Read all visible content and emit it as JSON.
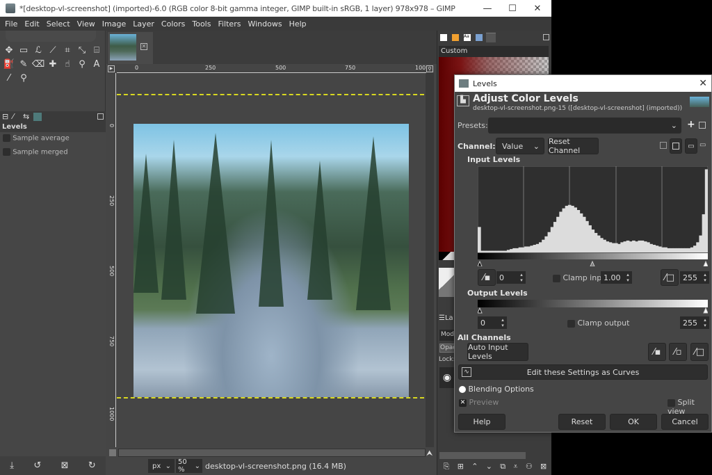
{
  "window": {
    "title": "*[desktop-vl-screenshot] (imported)-6.0 (RGB color 8-bit gamma integer, GIMP built-in sRGB, 1 layer) 978x978 – GIMP",
    "minimize": "—",
    "maximize": "☐",
    "close": "✕"
  },
  "menubar": [
    "File",
    "Edit",
    "Select",
    "View",
    "Image",
    "Layer",
    "Colors",
    "Tools",
    "Filters",
    "Windows",
    "Help"
  ],
  "toolbox": {
    "tools": [
      {
        "name": "move-tool",
        "glyph": "✥"
      },
      {
        "name": "rect-select-tool",
        "glyph": "▭"
      },
      {
        "name": "free-select-tool",
        "glyph": "ℒ"
      },
      {
        "name": "fuzzy-select-tool",
        "glyph": "⟋"
      },
      {
        "name": "crop-tool",
        "glyph": "⌗"
      },
      {
        "name": "unified-transform-tool",
        "glyph": "⤡"
      },
      {
        "name": "warp-transform-tool",
        "glyph": "⌸"
      },
      {
        "name": "bucket-fill-tool",
        "glyph": "⛽"
      },
      {
        "name": "paintbrush-tool",
        "glyph": "✎"
      },
      {
        "name": "eraser-tool",
        "glyph": "⌫"
      },
      {
        "name": "heal-tool",
        "glyph": "✚"
      },
      {
        "name": "smudge-tool",
        "glyph": "☝"
      },
      {
        "name": "dodge-burn-tool",
        "glyph": "⚲"
      },
      {
        "name": "text-tool",
        "glyph": "A"
      },
      {
        "name": "color-picker-tool",
        "glyph": "⁄"
      },
      {
        "name": "zoom-tool",
        "glyph": "⚲"
      }
    ],
    "fg_color": "#6a0000",
    "bg_color": "#ffffff",
    "tool_options_title": "Levels",
    "options": [
      "Sample average",
      "Sample merged"
    ]
  },
  "canvas": {
    "ruler_h": [
      "0",
      "250",
      "500",
      "750",
      "100"
    ],
    "ruler_v": [
      "0",
      "250",
      "500",
      "750",
      "1000"
    ],
    "unit": "px",
    "zoom": "50 %",
    "status": "desktop-vl-screenshot.png (16.4 MB)"
  },
  "right_dock": {
    "gradient_name": "Custom",
    "layers_tab": "La",
    "mode_label": "Mod",
    "opacity_label": "Opac",
    "lock_label": "Lock:"
  },
  "levels": {
    "window_title": "Levels",
    "header": "Adjust Color Levels",
    "subheader": "desktop-vl-screenshot.png-15 ([desktop-vl-screenshot] (imported))",
    "presets_label": "Presets:",
    "presets_value": "",
    "channel_label": "Channel:",
    "channel_value": "Value",
    "reset_channel": "Reset Channel",
    "input_levels_label": "Input Levels",
    "input_low": "0",
    "gamma": "1.00",
    "input_high": "255",
    "clamp_input": "Clamp input",
    "output_levels_label": "Output Levels",
    "output_low": "0",
    "output_high": "255",
    "clamp_output": "Clamp output",
    "all_channels_label": "All Channels",
    "auto_input": "Auto Input Levels",
    "edit_curves": "Edit these Settings as Curves",
    "blending_options": "Blending Options",
    "preview": "Preview",
    "preview_checked": true,
    "split_view": "Split view",
    "help": "Help",
    "reset": "Reset",
    "ok": "OK",
    "cancel": "Cancel",
    "histogram": [
      0.3,
      0.02,
      0.02,
      0.02,
      0.02,
      0.02,
      0.02,
      0.02,
      0.02,
      0.02,
      0.03,
      0.04,
      0.05,
      0.05,
      0.06,
      0.06,
      0.07,
      0.07,
      0.08,
      0.09,
      0.1,
      0.12,
      0.15,
      0.19,
      0.24,
      0.3,
      0.36,
      0.42,
      0.48,
      0.52,
      0.55,
      0.56,
      0.55,
      0.53,
      0.5,
      0.46,
      0.42,
      0.37,
      0.32,
      0.27,
      0.23,
      0.2,
      0.17,
      0.15,
      0.13,
      0.12,
      0.11,
      0.11,
      0.1,
      0.12,
      0.13,
      0.14,
      0.13,
      0.14,
      0.13,
      0.14,
      0.14,
      0.13,
      0.12,
      0.1,
      0.09,
      0.08,
      0.07,
      0.06,
      0.06,
      0.05,
      0.05,
      0.05,
      0.05,
      0.05,
      0.05,
      0.05,
      0.05,
      0.06,
      0.08,
      0.12,
      0.2,
      0.45,
      0.98
    ]
  }
}
